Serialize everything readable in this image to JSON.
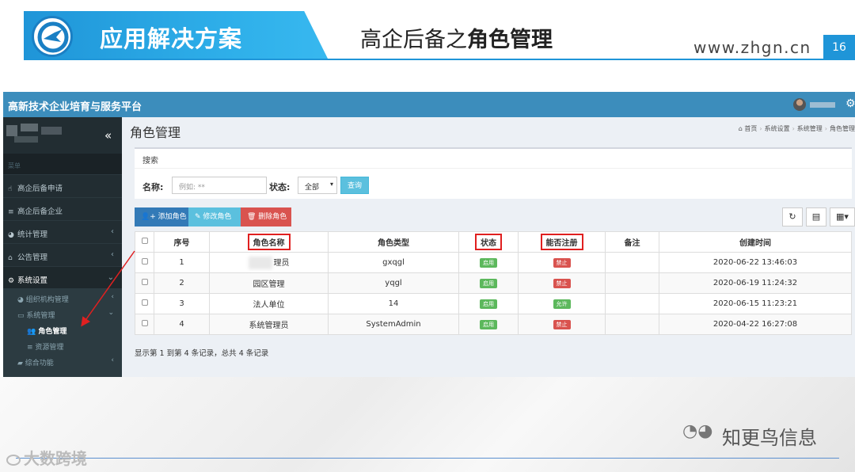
{
  "slide": {
    "banner_title": "应用解决方案",
    "title_prefix": "高企后备之",
    "title_bold": "角色管理",
    "site_url": "www.zhgn.cn",
    "page_number": "16",
    "wechat_name": "知更鸟信息",
    "watermark": "大数跨境",
    "brand_color": "#1f95d8"
  },
  "app": {
    "platform_title": "高新技术企业培育与服务平台",
    "topbar_color": "#3c8dbc",
    "sidebar": {
      "collapse_icon": "«",
      "menu_header": "菜单",
      "items": [
        {
          "label": "高企后备申请",
          "icon": "hand-icon"
        },
        {
          "label": "高企后备企业",
          "icon": "list-icon"
        },
        {
          "label": "统计管理",
          "icon": "pie-chart-icon"
        },
        {
          "label": "公告管理",
          "icon": "home-icon"
        },
        {
          "label": "系统设置",
          "icon": "gears-icon"
        }
      ],
      "sub_items": [
        {
          "label": "组织机构管理",
          "icon": "pie-chart-icon"
        },
        {
          "label": "系统管理",
          "icon": "desktop-icon"
        },
        {
          "label": "角色管理",
          "icon": "users-icon"
        },
        {
          "label": "资源管理",
          "icon": "list-icon"
        },
        {
          "label": "综合功能",
          "icon": "folder-icon"
        }
      ]
    },
    "content": {
      "title": "角色管理",
      "breadcrumb": [
        "首页",
        "系统设置",
        "系统管理",
        "角色管理"
      ],
      "search": {
        "title": "搜索",
        "name_label": "名称:",
        "name_placeholder": "例如: **",
        "status_label": "状态:",
        "status_value": "全部",
        "query_button": "查询"
      },
      "toolbar": {
        "add_label": "添加角色",
        "edit_label": "修改角色",
        "delete_label": "删除角色"
      },
      "table": {
        "columns": [
          "序号",
          "角色名称",
          "角色类型",
          "状态",
          "能否注册",
          "备注",
          "创建时间"
        ],
        "rows": [
          {
            "index": "1",
            "name": "理员",
            "type": "gxqgl",
            "status": "启用",
            "register": "禁止",
            "note": "",
            "created": "2020-06-22 13:46:03"
          },
          {
            "index": "2",
            "name": "园区管理",
            "type": "yqgl",
            "status": "启用",
            "register": "禁止",
            "note": "",
            "created": "2020-06-19 11:24:32"
          },
          {
            "index": "3",
            "name": "法人单位",
            "type": "14",
            "status": "启用",
            "register": "允许",
            "note": "",
            "created": "2020-06-15 11:23:21"
          },
          {
            "index": "4",
            "name": "系统管理员",
            "type": "SystemAdmin",
            "status": "启用",
            "register": "禁止",
            "note": "",
            "created": "2020-04-22 16:27:08"
          }
        ]
      },
      "record_info": "显示第 1 到第 4 条记录，总共 4 条记录"
    }
  }
}
